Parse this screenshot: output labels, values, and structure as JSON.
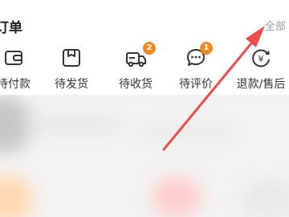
{
  "orders": {
    "title": "订单",
    "view_all": "全部",
    "items": [
      {
        "label": "待付款",
        "icon": "wallet-icon",
        "badge": ""
      },
      {
        "label": "待发货",
        "icon": "package-box-icon",
        "badge": ""
      },
      {
        "label": "待收货",
        "icon": "delivery-truck-icon",
        "badge": "2"
      },
      {
        "label": "待评价",
        "icon": "chat-bubble-icon",
        "badge": "1"
      },
      {
        "label": "退款/售后",
        "icon": "refund-yen-icon",
        "badge": ""
      }
    ]
  },
  "colors": {
    "badge": "#f08a24",
    "annotation_arrow": "#ee4b4b",
    "muted_text": "#9a9a9a"
  }
}
